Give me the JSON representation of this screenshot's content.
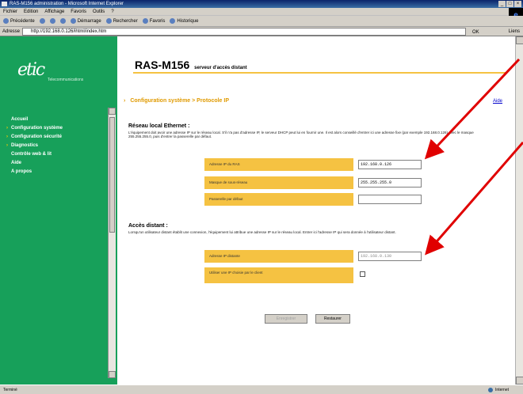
{
  "window": {
    "title": "RAS-M156 administration - Microsoft Internet Explorer",
    "controls": [
      "_",
      "□",
      "×"
    ]
  },
  "menubar": {
    "items": [
      "Fichier",
      "Edition",
      "Affichage",
      "Favoris",
      "Outils",
      "?"
    ]
  },
  "toolbar": {
    "items": [
      "Précédente",
      "Suivante",
      "Arrêter",
      "Actualiser",
      "Démarrage",
      "Rechercher",
      "Favoris",
      "Historique"
    ]
  },
  "addressbar": {
    "label": "Adresse",
    "url": "http://192.168.0.126/ihtml/index.htm",
    "go": "OK",
    "links": "Liens"
  },
  "sidebar": {
    "logo_text": "etic",
    "logo_tagline": "Telecommunications",
    "items": [
      {
        "label": "Accueil",
        "arrow": false
      },
      {
        "label": "Configuration système",
        "arrow": true
      },
      {
        "label": "Configuration sécurité",
        "arrow": true
      },
      {
        "label": "Diagnostics",
        "arrow": true
      },
      {
        "label": "Contrôle web & lit",
        "arrow": false
      },
      {
        "label": "Aide",
        "arrow": false
      },
      {
        "label": "A propos",
        "arrow": false
      }
    ]
  },
  "header": {
    "title": "RAS-M156",
    "subtitle": "serveur d'accès distant"
  },
  "breadcrumb": "Configuration système > Protocole IP",
  "help_link": "Aide",
  "section_local": {
    "title": "Réseau local Ethernet :",
    "description": "L'équipement doit avoir une adresse IP sur le réseau local. S'il n'a pas d'adresse IP, le serveur DHCP peut lui en fournir une. Il est alors conseillé d'entrer ici une adresse fixe (par exemple 192.168.0.126) avec le masque 255.255.255.0, puis d'entrer la passerelle par défaut.",
    "fields": [
      {
        "label": "Adresse IP du RAS",
        "value": "192.168.0.126",
        "type": "text"
      },
      {
        "label": "Masque de sous-réseau",
        "value": "255.255.255.0",
        "type": "text"
      },
      {
        "label": "Passerelle par défaut",
        "value": "",
        "type": "text"
      }
    ]
  },
  "section_remote": {
    "title": "Accès distant :",
    "description": "Lorsqu'un utilisateur distant établit une connexion, l'équipement lui attribue une adresse IP sur le réseau local. Entrer ici l'adresse IP qui sera donnée à l'utilisateur distant.",
    "fields": [
      {
        "label": "Adresse IP distante",
        "value": "192.168.0.130",
        "type": "text"
      },
      {
        "label": "Utiliser une IP choisie par le client",
        "value": "",
        "type": "checkbox"
      }
    ]
  },
  "buttons": {
    "save": "Enregistrer",
    "reset": "Restaurer"
  },
  "statusbar": {
    "left": "Terminé",
    "zone": "Internet"
  },
  "colors": {
    "sidebar": "#17a05a",
    "accent": "#f5c242",
    "crumb": "#e09a00",
    "arrow": "#e00000"
  }
}
